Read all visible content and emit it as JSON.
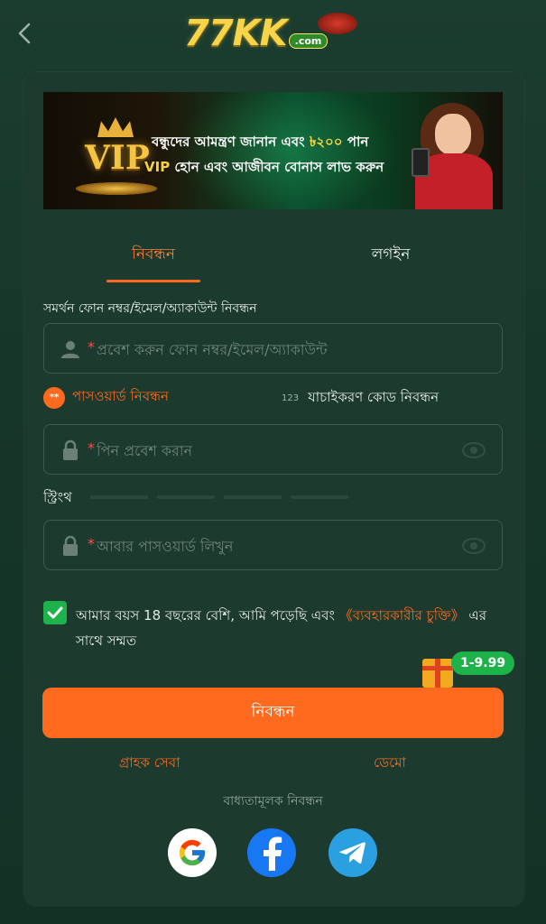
{
  "header": {
    "logo_main": "77KK",
    "logo_sub": ".com"
  },
  "banner": {
    "vip": "VIP",
    "line1_pre": "বন্ধুদের আমন্ত্রণ জানান এবং ",
    "line1_amount": "৳২০০",
    "line1_post": " পান",
    "line2_vip": "VIP",
    "line2_rest": " হোন এবং আজীবন বোনাস লাভ করুন"
  },
  "tabs": {
    "register": "নিবন্ধন",
    "login": "লগইন"
  },
  "form": {
    "section_label": "সমর্থন ফোন নম্বর/ইমেল/অ্যাকাউন্ট নিবন্ধন",
    "account_placeholder": "প্রবেশ করুন ফোন নম্বর/ইমেল/অ্যাকাউন্ট",
    "required_mark": "*",
    "password_register_label": "পাসওয়ার্ড নিবন্ধন",
    "password_register_dot": "**",
    "code_prefix": "123",
    "code_register_label": "যাচাইকরণ কোড নিবন্ধন",
    "pin_placeholder": "পিন প্রবেশ করান",
    "strength_label": "স্ট্রিংথ",
    "confirm_placeholder": "আবার পাসওয়ার্ড লিখুন",
    "agree_text": "আমার বয়স 18 বছরের বেশি, আমি পড়েছি এবং ",
    "agree_link": "《ব্যবহারকারীর চুক্তি》",
    "agree_suffix": " এর সাথে সম্মত",
    "agree_checked": true,
    "gift_badge": "1-9.99",
    "submit": "নিবন্ধন"
  },
  "footer": {
    "customer_service": "গ্রাহক সেবা",
    "demo": "ডেমো",
    "social_label": "বাধ্যতামূলক নিবন্ধন"
  },
  "colors": {
    "accent": "#ff6a1f",
    "background": "#163529",
    "card": "#1d3a2e",
    "success": "#1db34a"
  },
  "icons": [
    "back-icon",
    "user-icon",
    "lock-icon",
    "eye-icon",
    "check-icon",
    "gift-icon",
    "google-icon",
    "facebook-icon",
    "telegram-icon"
  ]
}
